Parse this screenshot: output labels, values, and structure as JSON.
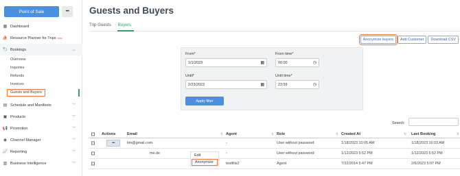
{
  "sidebar": {
    "pos_label": "Point of Sale",
    "pos_more": "•••",
    "items": [
      {
        "label": "Dashboard",
        "icon": "dashboard-icon"
      },
      {
        "label": "Resource Planner for Trips",
        "beta": "beta",
        "icon": "planner-icon"
      },
      {
        "label": "Bookings",
        "icon": "bookings-icon"
      },
      {
        "label": "Schedule and Manifests",
        "icon": "schedule-icon"
      },
      {
        "label": "Products",
        "icon": "products-icon"
      },
      {
        "label": "Promotion",
        "icon": "promotion-icon"
      },
      {
        "label": "Channel Manager",
        "icon": "channel-icon"
      },
      {
        "label": "Reporting",
        "icon": "reporting-icon"
      },
      {
        "label": "Business Intelligence",
        "icon": "bi-icon"
      }
    ],
    "bookings_sub": [
      "Overview",
      "Inquiries",
      "Refunds",
      "Invoices",
      "Guests and Buyers"
    ]
  },
  "header": {
    "title": "Guests and Buyers"
  },
  "tabs": [
    "Trip Guests",
    "Buyers"
  ],
  "actions": {
    "anonymize": "Anonymize buyers",
    "add": "Add Customer",
    "download": "Download CSV"
  },
  "filter": {
    "from_label": "From*",
    "from_value": "1/1/2023",
    "from_time_label": "From time*",
    "from_time_value": "00:00",
    "until_label": "Until*",
    "until_value": "2/23/2023",
    "until_time_label": "Until time*",
    "until_time_value": "23:59",
    "apply": "Apply filter"
  },
  "search_label": "Search:",
  "table": {
    "headers": [
      "Actions",
      "Email",
      "Agent",
      "Role",
      "Created At",
      "Last Booking"
    ],
    "rows": [
      {
        "email": "tim@gmail.com",
        "agent": "-",
        "role": "User without password",
        "created": "1/18/2023 10:05 AM",
        "last": "1/18/2023 10:03 AM"
      },
      {
        "email": "me.de",
        "agent": "-",
        "role": "User without password",
        "created": "1/12/2023 5:52 PM",
        "last": "1/12/2023 5:52 PM"
      },
      {
        "email": "",
        "agent": "testfilis2",
        "role": "Agent",
        "created": "7/22/2014 5:47 PM",
        "last": "2/6/2023 5:07 PM"
      }
    ]
  },
  "dropdown": {
    "edit": "Edit",
    "anonymize": "Anonymize"
  },
  "colors": {
    "accent": "#4a8fe0",
    "highlight": "#f07b3a",
    "active_tab": "#2f9e6e"
  }
}
